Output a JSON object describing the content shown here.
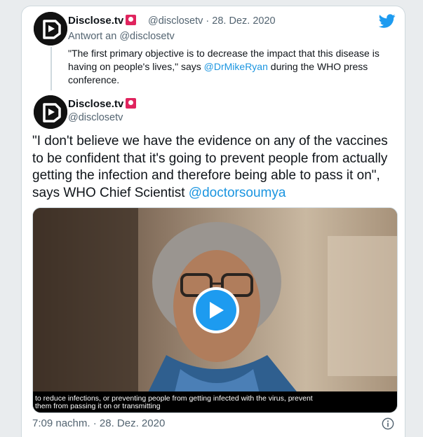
{
  "reply_tweet": {
    "name": "Disclose.tv",
    "handle": "@disclosetv",
    "separator": "·",
    "date": "28. Dez. 2020",
    "reply_to": "Antwort an @disclosetv",
    "text_part1": "\"The first primary objective is to decrease the impact that this disease is having on people's lives,\" says ",
    "mention": "@DrMikeRyan",
    "text_part2": " during the WHO press conference."
  },
  "main_tweet": {
    "name": "Disclose.tv",
    "handle": "@disclosetv",
    "text": "\"I don't believe we have the evidence on any of the vaccines to be confident that it's going to prevent people from actually getting the infection and therefore being able to pass it on\", says WHO Chief Scientist ",
    "mention": "@doctorsoumya",
    "video": {
      "subtitle_line1": "to reduce infections, or preventing people from getting infected with the virus, prevent",
      "subtitle_line2": "them from passing it on or transmitting"
    },
    "timestamp": "7:09 nachm. · 28. Dez. 2020"
  },
  "icons": {
    "logo": "twitter-bird-icon",
    "badge": "siren-icon",
    "play": "play-icon",
    "info": "info-icon"
  },
  "colors": {
    "accent": "#1d9bf0",
    "link": "#1b95e0",
    "badge": "#e0245e"
  }
}
